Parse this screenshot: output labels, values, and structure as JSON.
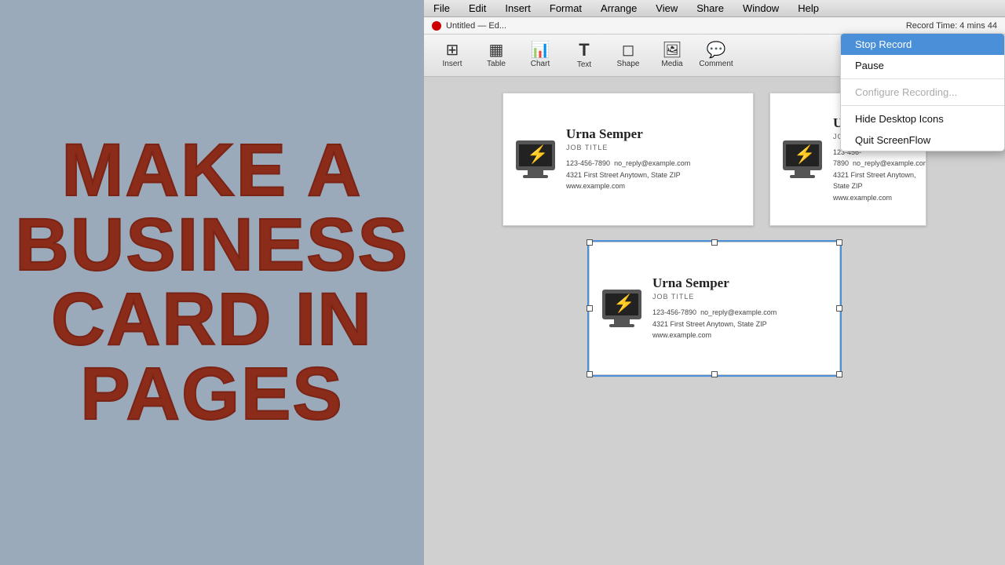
{
  "left_panel": {
    "text_line1": "MAKE A",
    "text_line2": "BUSINESS",
    "text_line3": "CARD IN",
    "text_line4": "PAGES"
  },
  "menu_bar": {
    "items": [
      "File",
      "Edit",
      "Insert",
      "Format",
      "Arrange",
      "View",
      "Share",
      "Window",
      "Help"
    ]
  },
  "record_bar": {
    "title": "Untitled — Ed...",
    "record_time": "Record Time: 4 mins 44"
  },
  "toolbar": {
    "buttons": [
      {
        "label": "Insert",
        "icon": "⊞"
      },
      {
        "label": "Table",
        "icon": "▦"
      },
      {
        "label": "Chart",
        "icon": "📊"
      },
      {
        "label": "Text",
        "icon": "T"
      },
      {
        "label": "Shape",
        "icon": "◻"
      },
      {
        "label": "Media",
        "icon": "🖼"
      },
      {
        "label": "Comment",
        "icon": "💬"
      }
    ]
  },
  "business_cards": [
    {
      "name": "Urna Semper",
      "job_title": "JOB TITLE",
      "phone": "123-456-7890",
      "email": "no_reply@example.com",
      "address1": "4321 First Street  Anytown, State  ZIP",
      "website": "www.example.com"
    },
    {
      "name": "Urna Se",
      "job_title": "JOB TITLE",
      "phone": "123-456-7890",
      "email": "no_reply@example.com",
      "address1": "4321 First Street  Anytown, State  ZIP",
      "website": "www.example.com"
    },
    {
      "name": "Urna Semper",
      "job_title": "JOB TITLE",
      "phone": "123-456-7890",
      "email": "no_reply@example.com",
      "address1": "4321 First Street  Anytown, State  ZIP",
      "website": "www.example.com",
      "selected": true
    }
  ],
  "dropdown": {
    "items": [
      {
        "label": "Stop Record",
        "type": "highlighted"
      },
      {
        "label": "Pause",
        "type": "normal"
      },
      {
        "label": "separator"
      },
      {
        "label": "Configure Recording...",
        "type": "disabled"
      },
      {
        "label": "separator"
      },
      {
        "label": "Hide Desktop Icons",
        "type": "normal"
      },
      {
        "label": "Quit ScreenFlow",
        "type": "normal"
      }
    ]
  }
}
